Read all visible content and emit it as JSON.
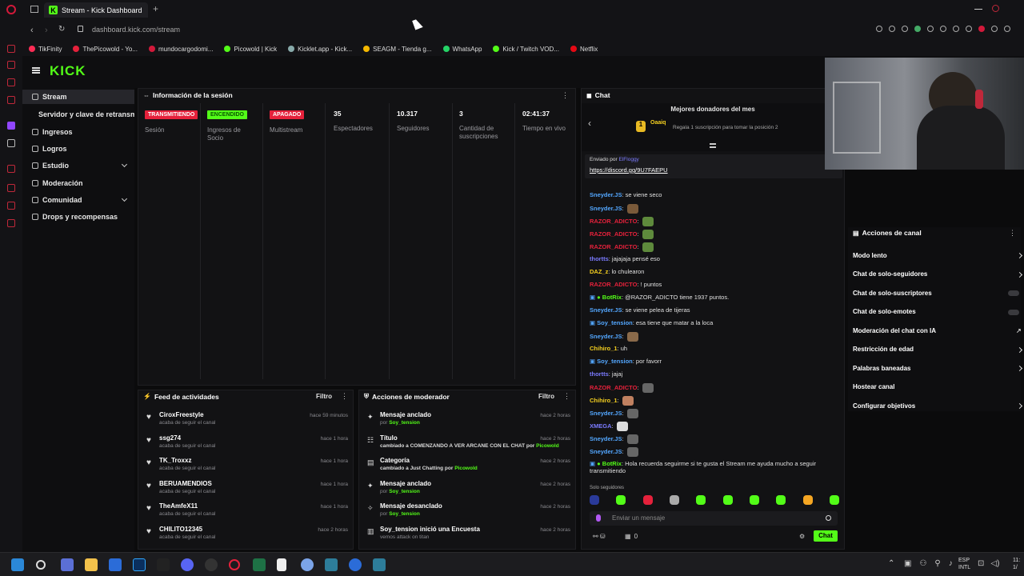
{
  "browser": {
    "tab_title": "Stream - Kick Dashboard",
    "url": "dashboard.kick.com/stream"
  },
  "bookmarks": [
    "TikFinity",
    "ThePicowold - Yo...",
    "mundocargodomi...",
    "Picowold | Kick",
    "Kicklet.app - Kick...",
    "SEAGM - Tienda g...",
    "WhatsApp",
    "Kick / Twitch VOD...",
    "Netflix"
  ],
  "logo": "KICK",
  "nav": {
    "items": [
      {
        "label": "Stream",
        "active": true
      },
      {
        "label": "Servidor y clave de retransmisión"
      },
      {
        "label": "Ingresos"
      },
      {
        "label": "Logros"
      },
      {
        "label": "Estudio",
        "chevron": true
      },
      {
        "label": "Moderación"
      },
      {
        "label": "Comunidad",
        "chevron": true
      },
      {
        "label": "Drops y recompensas"
      }
    ]
  },
  "session": {
    "title": "Información de la sesión",
    "stats": [
      {
        "badge": "TRANSMITIENDO",
        "badge_color": "#e5213b",
        "label": "Sesión"
      },
      {
        "badge": "ENCENDIDO",
        "badge_color": "#53fc18",
        "label": "Ingresos de Socio"
      },
      {
        "badge": "APAGADO",
        "badge_color": "#e5213b",
        "label": "Multistream"
      },
      {
        "value": "35",
        "label": "Espectadores"
      },
      {
        "value": "10.317",
        "label": "Seguidores"
      },
      {
        "value": "3",
        "label": "Cantidad de suscripciones"
      },
      {
        "value": "02:41:37",
        "label": "Tiempo en vivo"
      }
    ]
  },
  "feed": {
    "title": "Feed de actividades",
    "filter": "Filtro",
    "rows": [
      {
        "name": "CiroxFreestyle",
        "sub": "acaba de seguir el canal",
        "time": "hace 59 minutos"
      },
      {
        "name": "ssg274",
        "sub": "acaba de seguir el canal",
        "time": "hace 1 hora"
      },
      {
        "name": "TK_Troxxz",
        "sub": "acaba de seguir el canal",
        "time": "hace 1 hora"
      },
      {
        "name": "BERUAMENDIOS",
        "sub": "acaba de seguir el canal",
        "time": "hace 1 hora"
      },
      {
        "name": "TheAmfeX11",
        "sub": "acaba de seguir el canal",
        "time": "hace 1 hora"
      },
      {
        "name": "CHILITO12345",
        "sub": "acaba de seguir el canal",
        "time": "hace 2 horas"
      }
    ]
  },
  "modactions": {
    "title": "Acciones de moderador",
    "filter": "Filtro",
    "rows": [
      {
        "name": "Mensaje anclado",
        "sub": "por ",
        "sub_user": "Soy_tension",
        "time": "hace 2 horas"
      },
      {
        "name": "Título",
        "sub": "cambiado a COMENZANDO A VER ARCANE CON EL CHAT por ",
        "sub_user": "Picowold",
        "time": "hace 2 horas"
      },
      {
        "name": "Categoría",
        "sub": "cambiado a Just Chatting por ",
        "sub_user": "Picowold",
        "time": "hace 2 horas"
      },
      {
        "name": "Mensaje anclado",
        "sub": "por ",
        "sub_user": "Soy_tension",
        "time": "hace 2 horas"
      },
      {
        "name": "Mensaje desanclado",
        "sub": "por ",
        "sub_user": "Soy_tension",
        "time": "hace 2 horas"
      },
      {
        "name": "Soy_tension inició una Encuesta",
        "sub": "vemos attack on titan",
        "sub_user": "",
        "time": "hace 2 horas"
      }
    ]
  },
  "chat": {
    "title": "Chat",
    "donors_title": "Mejores donadores del mes",
    "donor": "Oaaiq",
    "donor_hint": "Regala 1 suscripción para tomar la posición 2",
    "pinned_by": "Enviado por",
    "pinned_user": "ElFloggy",
    "pinned_link": "https://discord.gg/9U7FAEPU",
    "messages": [
      {
        "u": "Sneyder.JS",
        "c": "#53a7ff",
        "t": ": se viene seco"
      },
      {
        "u": "Sneyder.JS",
        "c": "#53a7ff",
        "t": ":",
        "emo": true
      },
      {
        "u": "RAZOR_ADICTO",
        "c": "#e5213b",
        "t": ":",
        "emo": true
      },
      {
        "u": "RAZOR_ADICTO",
        "c": "#e5213b",
        "t": ":",
        "emo": true
      },
      {
        "u": "RAZOR_ADICTO",
        "c": "#e5213b",
        "t": ":",
        "emo": true
      },
      {
        "u": "thortts",
        "c": "#7b7bff",
        "t": ": jajajaja pensé eso"
      },
      {
        "u": "DAZ_z",
        "c": "#f5d020",
        "t": ": lo chulearon"
      },
      {
        "u": "RAZOR_ADICTO",
        "c": "#e5213b",
        "t": ": ! puntos"
      },
      {
        "u": "BotRix",
        "c": "#53fc18",
        "t": ": @RAZOR_ADICTO tiene 1937 puntos."
      },
      {
        "u": "Sneyder.JS",
        "c": "#53a7ff",
        "t": ": se viene pelea de tijeras"
      },
      {
        "u": "Soy_tension",
        "c": "#53a7ff",
        "t": ": esa tiene que matar a la loca"
      },
      {
        "u": "Sneyder.JS",
        "c": "#53a7ff",
        "t": ":",
        "emo": true
      },
      {
        "u": "Chihiro_1",
        "c": "#f5d020",
        "t": ": uh"
      },
      {
        "u": "Soy_tension",
        "c": "#53a7ff",
        "t": ": por favorr"
      },
      {
        "u": "thortts",
        "c": "#7b7bff",
        "t": ": jajaj"
      },
      {
        "u": "RAZOR_ADICTO",
        "c": "#e5213b",
        "t": ":",
        "emo": true
      },
      {
        "u": "Chihiro_1",
        "c": "#f5d020",
        "t": ":",
        "emo": true
      },
      {
        "u": "Sneyder.JS",
        "c": "#53a7ff",
        "t": ":",
        "emo": true
      },
      {
        "u": "XMEGA",
        "c": "#7b7bff",
        "t": ":",
        "emo": true
      },
      {
        "u": "Sneyder.JS",
        "c": "#53a7ff",
        "t": ":",
        "emo": true
      },
      {
        "u": "Sneyder.JS",
        "c": "#53a7ff",
        "t": ":",
        "emo": true
      },
      {
        "u": "BotRix",
        "c": "#53fc18",
        "t": ": Hola recuerda seguirme si te gusta el Stream me ayuda mucho a seguir transmitiendo"
      }
    ],
    "followers_only": "Solo seguidores",
    "placeholder": "Enviar un mensaje",
    "count": "0",
    "send": "Chat"
  },
  "actions": {
    "title": "Acciones de canal",
    "items": [
      {
        "label": "Modo lento",
        "kind": "arrow"
      },
      {
        "label": "Chat de solo-seguidores",
        "kind": "arrow"
      },
      {
        "label": "Chat de solo-suscriptores",
        "kind": "toggle"
      },
      {
        "label": "Chat de solo-emotes",
        "kind": "toggle"
      },
      {
        "label": "Moderación del chat con IA",
        "kind": "link"
      },
      {
        "label": "Restricción de edad",
        "kind": "arrow"
      },
      {
        "label": "Palabras baneadas",
        "kind": "arrow"
      },
      {
        "label": "Hostear canal",
        "kind": "none"
      },
      {
        "label": "Configurar objetivos",
        "kind": "arrow"
      }
    ]
  },
  "taskbar": {
    "lang": "ESP",
    "layout": "INTL",
    "time": "11:",
    "date": "1/"
  }
}
